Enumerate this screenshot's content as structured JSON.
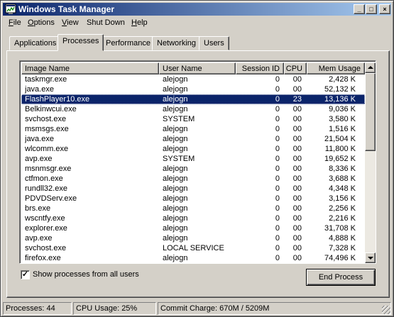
{
  "window": {
    "title": "Windows Task Manager",
    "buttons": {
      "minimize": "_",
      "maximize": "□",
      "close": "×"
    }
  },
  "menu": [
    {
      "label": "File",
      "u": "F",
      "rest": "ile"
    },
    {
      "label": "Options",
      "u": "O",
      "rest": "ptions"
    },
    {
      "label": "View",
      "u": "V",
      "rest": "iew"
    },
    {
      "label": "Shut Down",
      "u": "",
      "rest": "Shut Down"
    },
    {
      "label": "Help",
      "u": "H",
      "rest": "elp"
    }
  ],
  "tabs": [
    "Applications",
    "Processes",
    "Performance",
    "Networking",
    "Users"
  ],
  "active_tab": "Processes",
  "columns": [
    "Image Name",
    "User Name",
    "Session ID",
    "CPU",
    "Mem Usage"
  ],
  "processes": [
    {
      "image": "taskmgr.exe",
      "user": "alejogn",
      "session": "0",
      "cpu": "00",
      "mem": "2,428 K"
    },
    {
      "image": "java.exe",
      "user": "alejogn",
      "session": "0",
      "cpu": "00",
      "mem": "52,132 K"
    },
    {
      "image": "FlashPlayer10.exe",
      "user": "alejogn",
      "session": "0",
      "cpu": "23",
      "mem": "13,136 K",
      "selected": true
    },
    {
      "image": "Belkinwcui.exe",
      "user": "alejogn",
      "session": "0",
      "cpu": "00",
      "mem": "9,036 K"
    },
    {
      "image": "svchost.exe",
      "user": "SYSTEM",
      "session": "0",
      "cpu": "00",
      "mem": "3,580 K"
    },
    {
      "image": "msmsgs.exe",
      "user": "alejogn",
      "session": "0",
      "cpu": "00",
      "mem": "1,516 K"
    },
    {
      "image": "java.exe",
      "user": "alejogn",
      "session": "0",
      "cpu": "00",
      "mem": "21,504 K"
    },
    {
      "image": "wlcomm.exe",
      "user": "alejogn",
      "session": "0",
      "cpu": "00",
      "mem": "11,800 K"
    },
    {
      "image": "avp.exe",
      "user": "SYSTEM",
      "session": "0",
      "cpu": "00",
      "mem": "19,652 K"
    },
    {
      "image": "msnmsgr.exe",
      "user": "alejogn",
      "session": "0",
      "cpu": "00",
      "mem": "8,336 K"
    },
    {
      "image": "ctfmon.exe",
      "user": "alejogn",
      "session": "0",
      "cpu": "00",
      "mem": "3,688 K"
    },
    {
      "image": "rundll32.exe",
      "user": "alejogn",
      "session": "0",
      "cpu": "00",
      "mem": "4,348 K"
    },
    {
      "image": "PDVDServ.exe",
      "user": "alejogn",
      "session": "0",
      "cpu": "00",
      "mem": "3,156 K"
    },
    {
      "image": "brs.exe",
      "user": "alejogn",
      "session": "0",
      "cpu": "00",
      "mem": "2,256 K"
    },
    {
      "image": "wscntfy.exe",
      "user": "alejogn",
      "session": "0",
      "cpu": "00",
      "mem": "2,216 K"
    },
    {
      "image": "explorer.exe",
      "user": "alejogn",
      "session": "0",
      "cpu": "00",
      "mem": "31,708 K"
    },
    {
      "image": "avp.exe",
      "user": "alejogn",
      "session": "0",
      "cpu": "00",
      "mem": "4,888 K"
    },
    {
      "image": "svchost.exe",
      "user": "LOCAL SERVICE",
      "session": "0",
      "cpu": "00",
      "mem": "7,328 K"
    },
    {
      "image": "firefox.exe",
      "user": "alejogn",
      "session": "0",
      "cpu": "00",
      "mem": "74,496 K"
    }
  ],
  "show_all_label": "Show processes from all users",
  "show_all_checked": true,
  "end_process_label": "End Process",
  "status": {
    "processes": "Processes: 44",
    "cpu": "CPU Usage: 25%",
    "commit": "Commit Charge: 670M / 5209M"
  },
  "colors": {
    "title_start": "#0a246a",
    "title_end": "#a6caf0",
    "face": "#d4d0c8",
    "selection": "#0a246a"
  }
}
